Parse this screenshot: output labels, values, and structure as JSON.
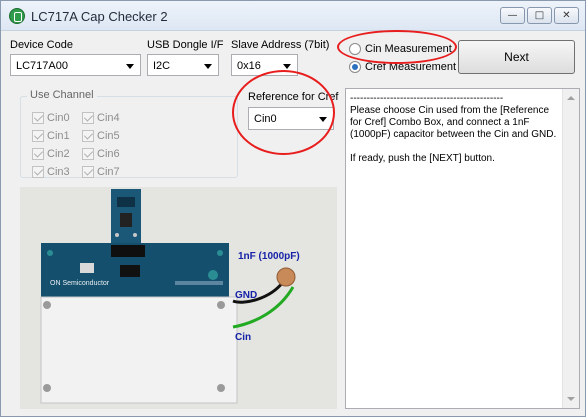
{
  "window": {
    "title": "LC717A Cap Checker 2",
    "controls": [
      "minimize",
      "maximize",
      "close"
    ]
  },
  "device_code": {
    "label": "Device Code",
    "value": "LC717A00"
  },
  "usb_dongle": {
    "label": "USB Dongle I/F",
    "value": "I2C"
  },
  "slave_address": {
    "label": "Slave Address (7bit)",
    "value": "0x16"
  },
  "measurement": {
    "cin_label": "Cin Measurement",
    "cref_label": "Cref Measurement",
    "selected": "cref"
  },
  "next_button": {
    "label": "Next"
  },
  "use_channel": {
    "title": "Use Channel",
    "channels": [
      "Cin0",
      "Cin1",
      "Cin2",
      "Cin3",
      "Cin4",
      "Cin5",
      "Cin6",
      "Cin7"
    ]
  },
  "reference": {
    "title": "Reference for Cref",
    "value": "Cin0"
  },
  "instructions": {
    "text": "----------------------------------------------\nPlease choose Cin used from the [Reference for Cref] Combo Box, and connect a 1nF (1000pF) capacitor between the Cin and GND.\n\nIf ready, push the [NEXT] button."
  },
  "photo": {
    "board_label": "ON Semiconductor",
    "capacitor_label": "1nF (1000pF)",
    "gnd_label": "GND",
    "cin_label": "Cin"
  },
  "colors": {
    "callout": "#e81d1d",
    "radio_selected": "#2b6fbf",
    "board": "#14506e",
    "annotation_text": "#1522a8"
  }
}
